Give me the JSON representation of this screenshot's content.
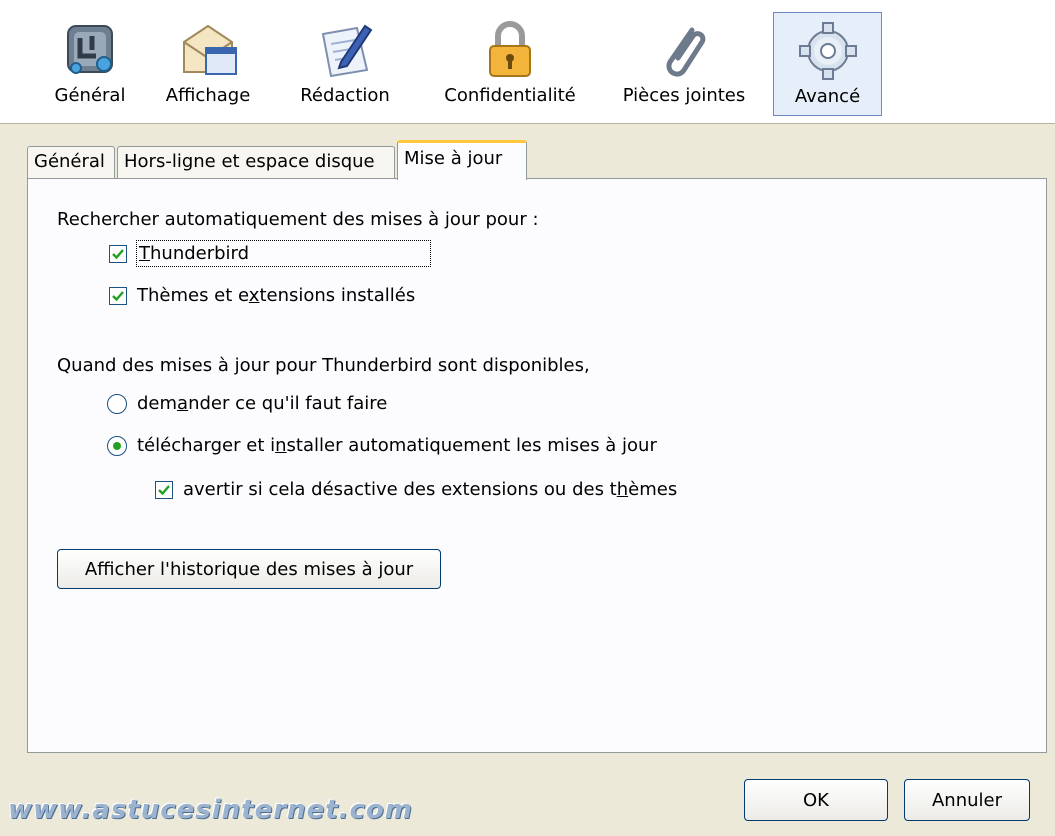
{
  "toolbar": {
    "items": [
      {
        "label": "Général",
        "icon": "general-icon",
        "selected": false
      },
      {
        "label": "Affichage",
        "icon": "envelope-window-icon",
        "selected": false
      },
      {
        "label": "Rédaction",
        "icon": "pen-paper-icon",
        "selected": false
      },
      {
        "label": "Confidentialité",
        "icon": "padlock-icon",
        "selected": false
      },
      {
        "label": "Pièces jointes",
        "icon": "paperclip-icon",
        "selected": false
      },
      {
        "label": "Avancé",
        "icon": "gear-icon",
        "selected": true
      }
    ]
  },
  "tabs": [
    {
      "label": "Général",
      "active": false
    },
    {
      "label": "Hors-ligne et espace disque",
      "active": false
    },
    {
      "label": "Mise à jour",
      "active": true
    }
  ],
  "panel": {
    "auto_check_heading": "Rechercher automatiquement des mises à jour pour :",
    "check_thunderbird": {
      "label": "Thunderbird",
      "checked": true
    },
    "check_themes": {
      "label": "Thèmes et extensions installés",
      "checked": true
    },
    "when_heading": "Quand des mises à jour pour Thunderbird sont disponibles,",
    "radio_ask": {
      "label": "demander ce qu'il faut faire",
      "selected": false
    },
    "radio_auto": {
      "label": "télécharger et installer automatiquement les mises à jour",
      "selected": true
    },
    "check_warn": {
      "label": "avertir si cela désactive des extensions ou des thèmes",
      "checked": true
    },
    "history_button": "Afficher l'historique des mises à jour"
  },
  "footer": {
    "ok_label": "OK",
    "cancel_label": "Annuler",
    "watermark": "www.astucesinternet.com"
  },
  "colors": {
    "dialog_bg": "#ece9d8",
    "selected_toolbar_bg": "#e6eef9",
    "active_tab_accent": "#ffc73c",
    "checkmark": "#21a121"
  }
}
